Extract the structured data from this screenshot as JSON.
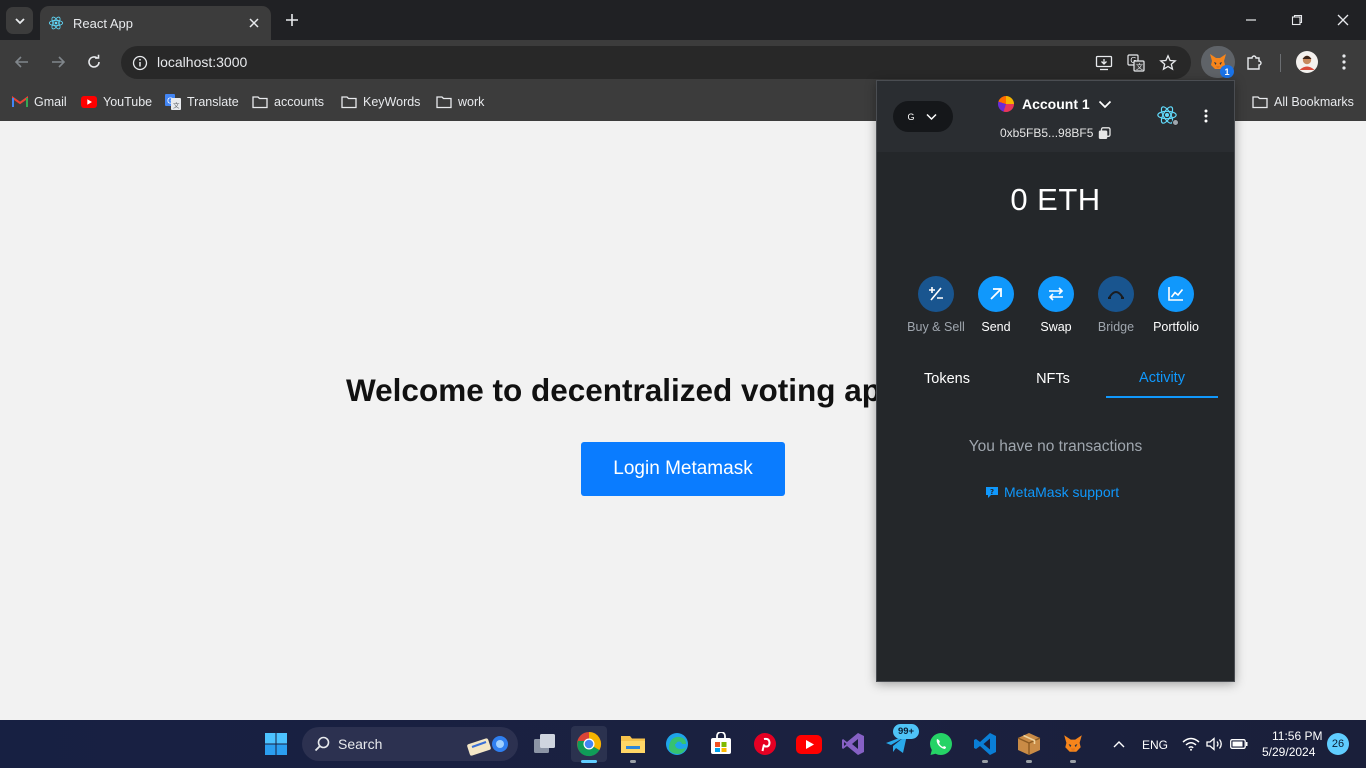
{
  "browser": {
    "tab_title": "React App",
    "url": "localhost:3000",
    "extension_badge": "1"
  },
  "bookmarks": [
    {
      "label": "Gmail",
      "icon": "gmail-icon"
    },
    {
      "label": "YouTube",
      "icon": "youtube-icon"
    },
    {
      "label": "Translate",
      "icon": "translate-icon"
    },
    {
      "label": "accounts",
      "icon": "folder-icon"
    },
    {
      "label": "KeyWords",
      "icon": "folder-icon"
    },
    {
      "label": "work",
      "icon": "folder-icon"
    }
  ],
  "all_bookmarks": "All Bookmarks",
  "page": {
    "heading": "Welcome to decentralized voting ap",
    "login_button": "Login Metamask"
  },
  "metamask": {
    "network_letter": "G",
    "account_name": "Account 1",
    "address": "0xb5FB5...98BF5",
    "balance": "0 ETH",
    "actions": [
      {
        "label": "Buy & Sell",
        "enabled": true
      },
      {
        "label": "Send",
        "enabled": true
      },
      {
        "label": "Swap",
        "enabled": true
      },
      {
        "label": "Bridge",
        "enabled": false
      },
      {
        "label": "Portfolio",
        "enabled": true
      }
    ],
    "tabs": [
      "Tokens",
      "NFTs",
      "Activity"
    ],
    "active_tab": "Activity",
    "empty_message": "You have no transactions",
    "support_link": "MetaMask support",
    "accent_color": "#1098fc"
  },
  "taskbar": {
    "search_label": "Search",
    "chat_badge": "99+",
    "language": "ENG",
    "time": "11:56 PM",
    "date": "5/29/2024",
    "notification_count": "26"
  }
}
